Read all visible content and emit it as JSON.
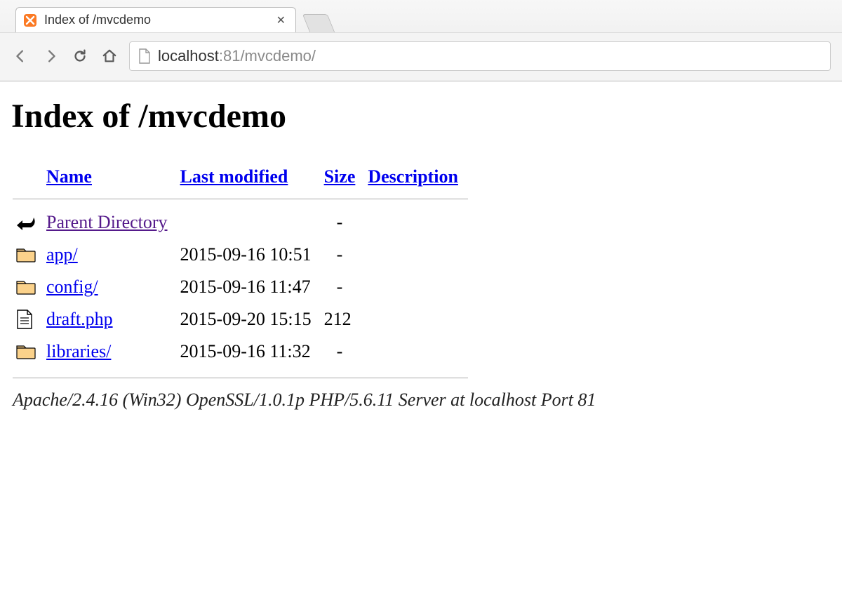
{
  "browser": {
    "tab_title": "Index of /mvcdemo",
    "url_host": "localhost",
    "url_port": ":81",
    "url_path": "/mvcdemo/"
  },
  "page": {
    "heading": "Index of /mvcdemo",
    "columns": {
      "name": "Name",
      "last_modified": "Last modified",
      "size": "Size",
      "description": "Description"
    },
    "parent_link": "Parent Directory",
    "rows": [
      {
        "icon": "folder",
        "name": "app/",
        "modified": "2015-09-16 10:51",
        "size": "-",
        "desc": ""
      },
      {
        "icon": "folder",
        "name": "config/",
        "modified": "2015-09-16 11:47",
        "size": "-",
        "desc": ""
      },
      {
        "icon": "file",
        "name": "draft.php",
        "modified": "2015-09-20 15:15",
        "size": "212",
        "desc": ""
      },
      {
        "icon": "folder",
        "name": "libraries/",
        "modified": "2015-09-16 11:32",
        "size": "-",
        "desc": ""
      }
    ],
    "server_signature": "Apache/2.4.16 (Win32) OpenSSL/1.0.1p PHP/5.6.11 Server at localhost Port 81"
  }
}
